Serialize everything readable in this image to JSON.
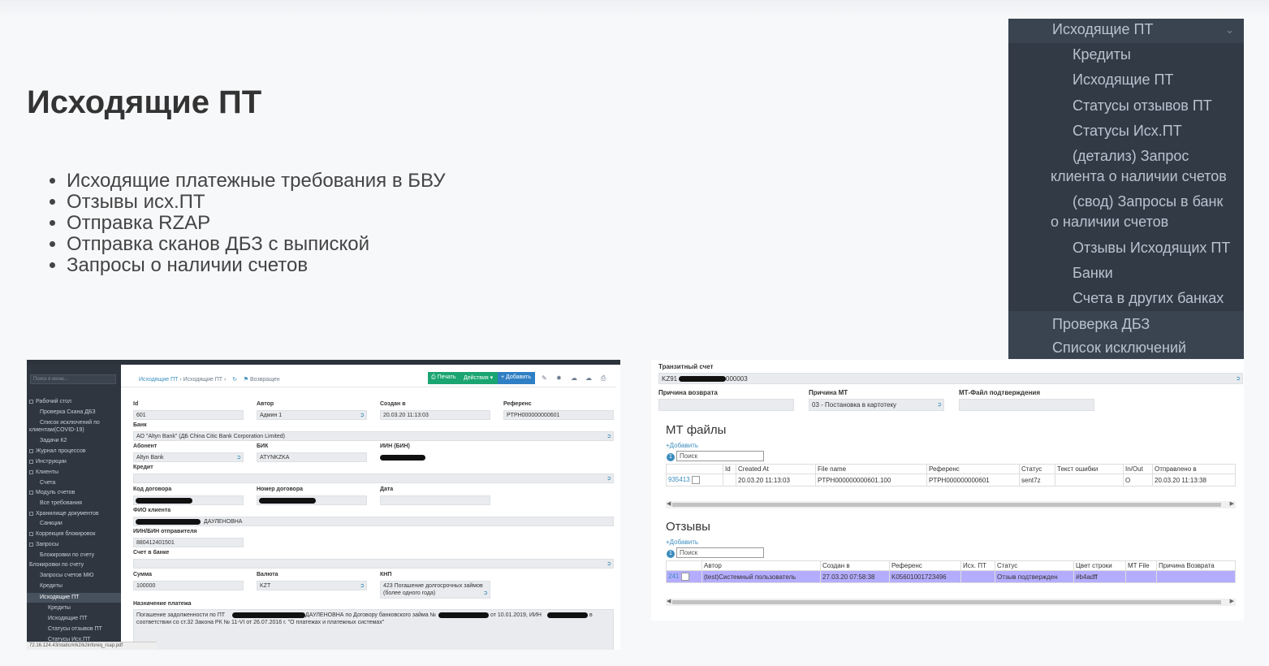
{
  "slide": {
    "title": "Исходящие ПТ",
    "bullets": [
      "Исходящие платежные требования в БВУ",
      "Отзывы исх.ПТ",
      "Отправка RZAP",
      "Отправка сканов ДБЗ с выпиской",
      "Запросы о наличии счетов"
    ]
  },
  "menu": {
    "group": "Исходящие ПТ",
    "items": [
      "Кредиты",
      "Исходящие ПТ",
      "Статусы отзывов ПТ",
      "Статусы Исх.ПТ"
    ],
    "detail_l1": "(детализ) Запрос",
    "detail_l2": "клиента о наличии счетов",
    "svod_l1": "(свод) Запросы в банк",
    "svod_l2": "о наличии счетов",
    "items2": [
      "Отзывы Исходящих ПТ",
      "Банки",
      "Счета в других банках"
    ],
    "top": [
      "Проверка ДБЗ",
      "Список исключений"
    ]
  },
  "shot1": {
    "search_placeholder": "Поиск в меню...",
    "sidebar": [
      "Рабочий стол",
      "Проверка Скана ДБЗ",
      "Список исключений по",
      "клиентам(COVID-19)",
      "Задачи К2",
      "Журнал процессов",
      "Инструкции",
      "Клиенты",
      "Счета",
      "Модуль счетов",
      "Все требования",
      "Хранилище документов",
      "Санкции",
      "Коррекция блокировок",
      "Запросы",
      "Блокировки по счету",
      "Блокировки по счету",
      "Запросы счетов МЮ",
      "Кредиты",
      "Исходящие ПТ",
      "Кредиты",
      "Исходящие ПТ",
      "Статусы отзывов ПТ",
      "Статусы Исх.ПТ"
    ],
    "crumb_1": "Исходящие ПТ",
    "crumb_2": "Исходящие ПТ",
    "status": "Возвращен",
    "btn_print": "Печать",
    "btn_actions": "Действия",
    "btn_add": "Добавить",
    "labels": {
      "id": "Id",
      "author": "Автор",
      "created": "Создан в",
      "ref": "Референс",
      "bank": "Банк",
      "abonent": "Абонент",
      "bik": "БИК",
      "iin": "ИИН (БИН)",
      "credit": "Кредит",
      "contract_code": "Код договора",
      "contract_num": "Номер договора",
      "date": "Дата",
      "fio": "ФИО клиента",
      "sender_iin": "ИИН/БИН отправителя",
      "bank_account": "Счет в банке",
      "sum": "Сумма",
      "currency": "Валюта",
      "knp": "КНП",
      "purpose": "Назначение платежа"
    },
    "values": {
      "id": "601",
      "author": "Админ 1",
      "created": "20.03.20 11:13:03",
      "ref": "PTPH000000000601",
      "bank": "АО \"Altyn Bank\" (ДБ China Citic Bank Corporation Limited)",
      "abonent": "Altyn Bank",
      "bik": "ATYNKZKA",
      "fio_tail": "ДАУЛЕНОВНА",
      "sender_iin": "880412401501",
      "sum": "100000",
      "currency": "KZT",
      "knp_1": "423 Погашение долгосрочных займов",
      "knp_2": "(более одного года)",
      "purpose_a": "Погашение задолженности по ПТ",
      "purpose_b": "ДАУЛЕНОВНА по Договору банковского займа №",
      "purpose_c": "от 10.01.2019, ИИН",
      "purpose_d": "в",
      "purpose_2": "соответствии со ст.32 Закона РК № 11-VI от 26.07.2016 г. \"О платежах и платежных системах\""
    },
    "status_bar": "72.16.124.43/static/#/k2/k2inforeq_rsap.pdf"
  },
  "shot2": {
    "transit_label": "Транзитный счет",
    "transit_prefix": "KZ91",
    "transit_suffix": "000003",
    "return_reason": "Причина возврата",
    "mt_reason": "Причина МТ",
    "mt_reason_value": "03 - Постановка в картотеку",
    "mt_file_confirm": "МТ-Файл подтверждения",
    "mt_files_title": "МТ файлы",
    "add": "Добавить",
    "search": "Поиск",
    "count": "1",
    "mt_headers": [
      "",
      "Id",
      "Created At",
      "File name",
      "Референс",
      "Статус",
      "Текст ошибки",
      "In/Out",
      "Отправлено в"
    ],
    "mt_row": [
      "935413",
      "",
      "20.03.20 11:13:03",
      "PTPH000000000601.100",
      "PTPH000000000601",
      "sent7z",
      "",
      "O",
      "20.03.20 11:13:38"
    ],
    "recalls_title": "Отзывы",
    "rc_headers": [
      "",
      "Автор",
      "Создан в",
      "Референс",
      "Исх. ПТ",
      "Статус",
      "Цвет строки",
      "MT File",
      "Причина Возврата"
    ],
    "rc_row": [
      "241",
      "(test)Системный пользователь",
      "27.03.20 07:58:38",
      "K05601001723496",
      "",
      "Отзыв подтвержден",
      "#b4adff",
      "",
      ""
    ]
  },
  "colors": {
    "menu_bg": "#3a4350",
    "highlight_row": "#b4adff",
    "accent": "#3b8dbd",
    "green_btn": "#1aa573"
  }
}
